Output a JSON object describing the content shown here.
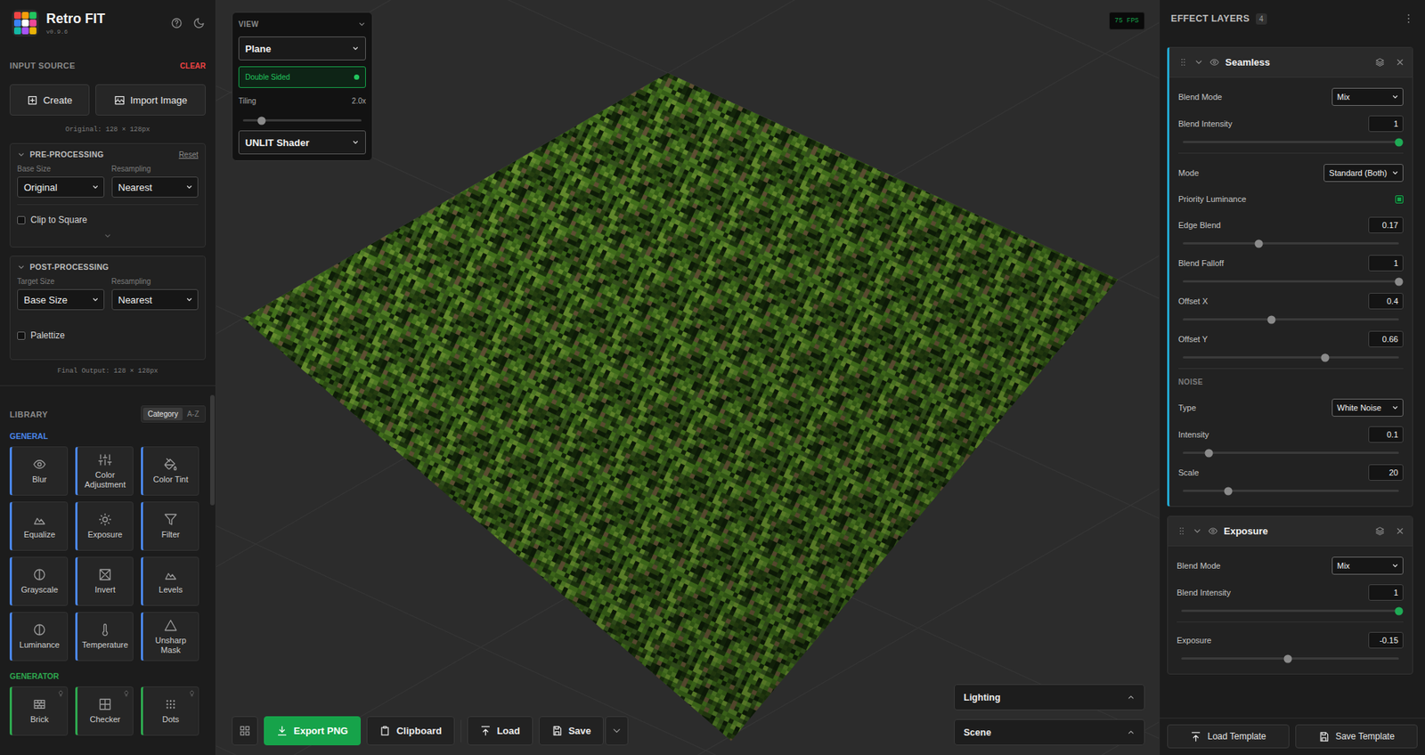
{
  "app": {
    "title": "Retro FIT",
    "version": "v0.9.6"
  },
  "input_source": {
    "title": "INPUT SOURCE",
    "clear": "CLEAR",
    "buttons": [
      "Create",
      "Import Image"
    ],
    "original": "Original: 128 × 128px"
  },
  "pre_processing": {
    "title": "PRE-PROCESSING",
    "expanded": true,
    "reset": "Reset",
    "fields": [
      {
        "label": "Base Size",
        "value": "Original"
      },
      {
        "label": "Resampling",
        "value": "Nearest"
      }
    ],
    "options": [
      {
        "label": "Clip to Square",
        "checked": false
      }
    ],
    "more_expanded": false
  },
  "post_processing": {
    "title": "POST-PROCESSING",
    "expanded": true,
    "fields": [
      {
        "label": "Target Size",
        "value": "Base Size"
      },
      {
        "label": "Resampling",
        "value": "Nearest"
      }
    ],
    "options": [
      {
        "label": "Palettize",
        "checked": false
      }
    ]
  },
  "final_output": "Final Output: 128 × 128px",
  "library": {
    "title": "LIBRARY",
    "sort": [
      {
        "label": "Category",
        "selected": true
      },
      {
        "label": "A-Z",
        "selected": false
      }
    ],
    "categories": [
      {
        "name": "GENERAL",
        "color": "#4a86e8",
        "items": [
          {
            "label": "Blur",
            "hint": false
          },
          {
            "label": "Color Adjustment",
            "hint": false
          },
          {
            "label": "Color Tint",
            "hint": false
          },
          {
            "label": "Equalize",
            "hint": false
          },
          {
            "label": "Exposure",
            "hint": false
          },
          {
            "label": "Filter",
            "hint": false
          },
          {
            "label": "Grayscale",
            "hint": false
          },
          {
            "label": "Invert",
            "hint": false
          },
          {
            "label": "Levels",
            "hint": false
          },
          {
            "label": "Luminance",
            "hint": false
          },
          {
            "label": "Temperature",
            "hint": false
          },
          {
            "label": "Unsharp Mask",
            "hint": false
          }
        ]
      },
      {
        "name": "GENERATOR",
        "color": "#2ea84f",
        "items": [
          {
            "label": "Brick",
            "hint": true
          },
          {
            "label": "Checker",
            "hint": true
          },
          {
            "label": "Dots",
            "hint": true
          }
        ]
      }
    ]
  },
  "viewport": {
    "view": {
      "title": "VIEW",
      "expanded": true,
      "shape": "Plane",
      "double_sided": {
        "label": "Double Sided",
        "on": true
      },
      "tiling": {
        "label": "Tiling",
        "reading": "2.0x",
        "level": 0.16
      },
      "shader": "UNLIT Shader"
    },
    "fps": "75 FPS",
    "panels": [
      {
        "title": "Lighting",
        "expanded": false
      },
      {
        "title": "Scene",
        "expanded": false
      }
    ]
  },
  "toolbar": {
    "buttons": [
      {
        "label": "Export PNG",
        "primary": true
      },
      {
        "label": "Clipboard",
        "primary": false
      },
      {
        "label": "Load",
        "primary": false
      },
      {
        "label": "Save",
        "primary": false
      }
    ]
  },
  "effect_layers": {
    "title": "EFFECT LAYERS",
    "count": "4",
    "layers": [
      {
        "name": "Seamless",
        "selected": true,
        "expanded": true,
        "visible": true,
        "blend": [
          {
            "kind": "select",
            "label": "Blend Mode",
            "value": "Mix"
          },
          {
            "kind": "slider",
            "label": "Blend Intensity",
            "value": "1",
            "level": 1,
            "color": "#1faa55"
          }
        ],
        "params": [
          {
            "kind": "select",
            "label": "Mode",
            "value": "Standard (Both)"
          },
          {
            "kind": "checkbox",
            "label": "Priority Luminance",
            "checked": true
          },
          {
            "kind": "slider",
            "label": "Edge Blend",
            "value": "0.17",
            "level": 0.35,
            "color": "#8a8a8a"
          },
          {
            "kind": "slider",
            "label": "Blend Falloff",
            "value": "1",
            "level": 1,
            "color": "#8a8a8a"
          },
          {
            "kind": "slider",
            "label": "Offset X",
            "value": "0.4",
            "level": 0.41,
            "color": "#8a8a8a"
          },
          {
            "kind": "slider",
            "label": "Offset Y",
            "value": "0.66",
            "level": 0.66,
            "color": "#8a8a8a"
          },
          {
            "kind": "section",
            "label": "NOISE"
          },
          {
            "kind": "select",
            "label": "Type",
            "value": "White Noise"
          },
          {
            "kind": "slider",
            "label": "Intensity",
            "value": "0.1",
            "level": 0.12,
            "color": "#8a8a8a"
          },
          {
            "kind": "slider",
            "label": "Scale",
            "value": "20",
            "level": 0.21,
            "color": "#8a8a8a"
          }
        ]
      },
      {
        "name": "Exposure",
        "selected": false,
        "expanded": true,
        "visible": true,
        "blend": [
          {
            "kind": "select",
            "label": "Blend Mode",
            "value": "Mix"
          },
          {
            "kind": "slider",
            "label": "Blend Intensity",
            "value": "1",
            "level": 1,
            "color": "#1faa55"
          }
        ],
        "params": [
          {
            "kind": "slider",
            "label": "Exposure",
            "value": "-0.15",
            "level": 0.49,
            "color": "#8a8a8a"
          }
        ]
      }
    ]
  },
  "templates": {
    "buttons": [
      "Load Template",
      "Save Template"
    ]
  }
}
